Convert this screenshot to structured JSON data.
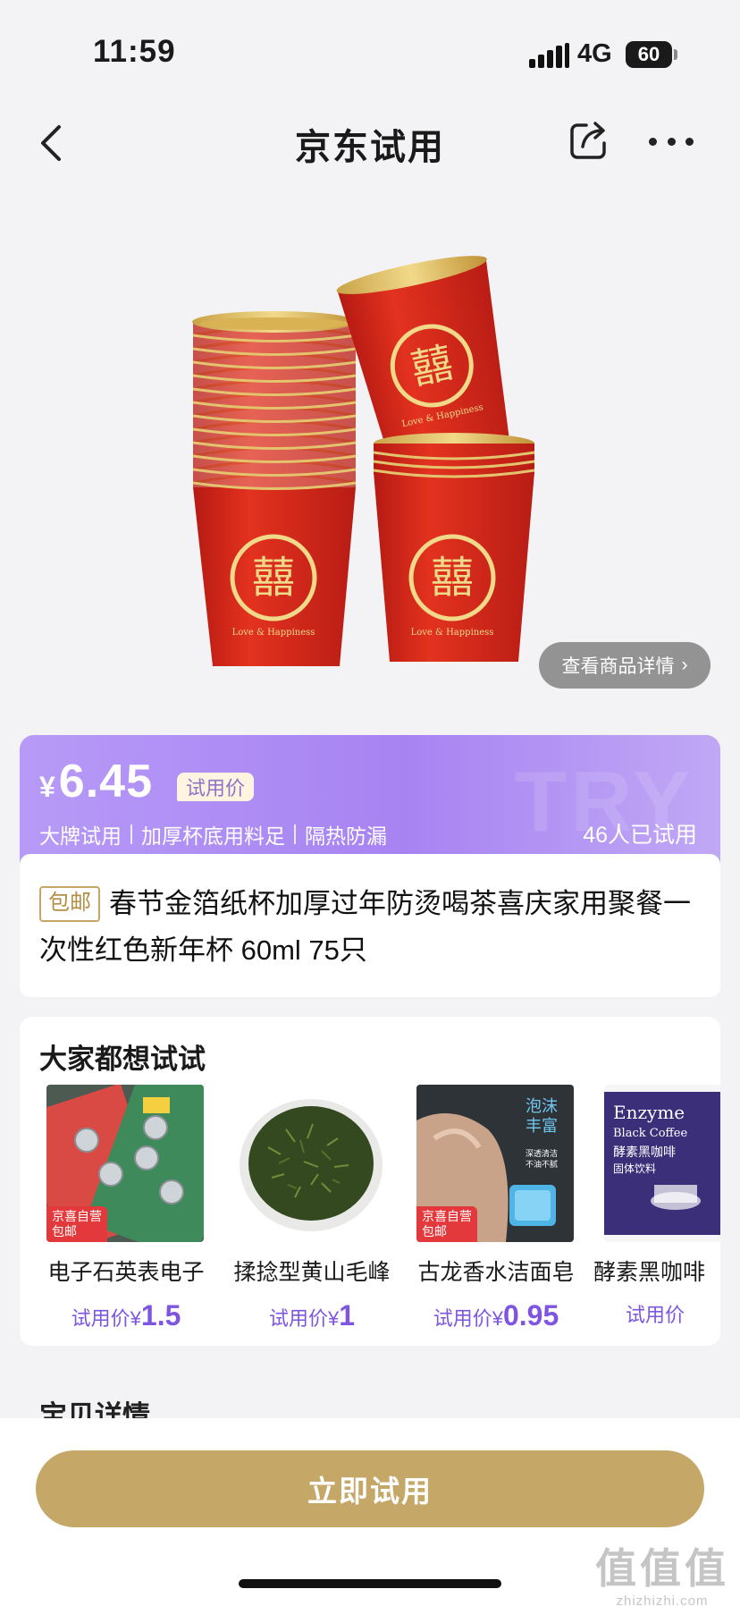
{
  "status_bar": {
    "time": "11:59",
    "network": "4G",
    "battery": "60"
  },
  "nav": {
    "title": "京东试用",
    "back_icon": "chevron-left-icon",
    "share_icon": "share-icon",
    "more_icon": "more-dots-icon"
  },
  "hero": {
    "cup_text": "Love & Happiness",
    "view_details_label": "查看商品详情",
    "view_details_arrow": "›"
  },
  "price_card": {
    "currency": "¥",
    "price": "6.45",
    "trial_tag": "试用价",
    "watermark": "TRY",
    "features": [
      "大牌试用",
      "加厚杯底用料足",
      "隔热防漏"
    ],
    "tried_count": "46人已试用"
  },
  "product": {
    "shipping_badge": "包邮",
    "title": "春节金箔纸杯加厚过年防烫喝茶喜庆家用聚餐一次性红色新年杯 60ml 75只"
  },
  "recommendations": {
    "heading": "大家都想试试",
    "items": [
      {
        "name": "电子石英表电子",
        "price_label": "试用价",
        "currency": "¥",
        "price": "1.5",
        "badge_line1": "京喜自营",
        "badge_line2": "包邮"
      },
      {
        "name": "揉捻型黄山毛峰",
        "price_label": "试用价",
        "currency": "¥",
        "price": "1"
      },
      {
        "name": "古龙香水洁面皂",
        "price_label": "试用价",
        "currency": "¥",
        "price": "0.95",
        "badge_line1": "京喜自营",
        "badge_line2": "包邮",
        "thumb_text_1": "泡沫",
        "thumb_text_2": "丰富",
        "thumb_text_3": "深透清洁",
        "thumb_text_4": "不油不腻"
      },
      {
        "name": "酵素黑咖啡",
        "price_label": "试用价",
        "thumb_text_1": "Enzyme",
        "thumb_text_2": "Black Coffee",
        "thumb_text_3": "酵素黑咖啡",
        "thumb_text_4": "固体饮料"
      }
    ]
  },
  "section_heading": "宝贝详情",
  "cta": {
    "label": "立即试用"
  },
  "watermark": {
    "big": "值值值",
    "small": "zhizhizhi.com"
  },
  "colors": {
    "accent_purple": "#a783f2",
    "cta_gold": "#c5a767",
    "cup_red": "#d8261c",
    "gold": "#e6c46a"
  }
}
